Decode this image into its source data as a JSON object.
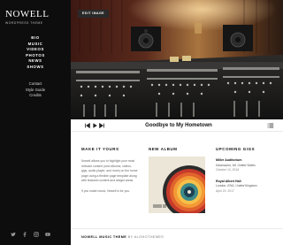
{
  "site": {
    "title": "NOWELL",
    "tagline": "WORDPRESS THEME"
  },
  "main_nav": [
    "BIO",
    "MUSIC",
    "VIDEOS",
    "PHOTOS",
    "NEWS",
    "SHOWS"
  ],
  "secondary_nav": [
    "Contact",
    "Style Guide",
    "Credits"
  ],
  "social_icons": [
    "twitter-icon",
    "facebook-icon",
    "instagram-icon",
    "youtube-icon"
  ],
  "hero": {
    "edit_label": "EDIT IMAGE"
  },
  "player": {
    "track_title": "Goodbye to My Hometown"
  },
  "make_it_yours": {
    "heading": "MAKE IT YOURS",
    "paragraph1": "Nowell allows you to highlight your most relevant content (new albums, videos, gigs, audio player, and more) on the home page using a flexible page template along with featured content and widget areas.",
    "paragraph2": "If you make music, Nowell is for you."
  },
  "new_album": {
    "heading": "NEW ALBUM"
  },
  "upcoming_gigs": {
    "heading": "UPCOMING GIGS",
    "gigs": [
      {
        "venue": "Miller Auditorium",
        "city": "Kalamazoo, MI, United States",
        "date": "October 10, 2016"
      },
      {
        "venue": "Royal Albert Hall",
        "city": "London, ENG, United Kingdom",
        "date": "April 20, 2017"
      }
    ]
  },
  "footer": {
    "theme_name": "NOWELL MUSIC THEME",
    "byline": "BY ALOHOTHEMES"
  },
  "colors": {
    "sidebar_bg": "#0d0d0d",
    "text_dark": "#111111",
    "muted": "#666666"
  }
}
